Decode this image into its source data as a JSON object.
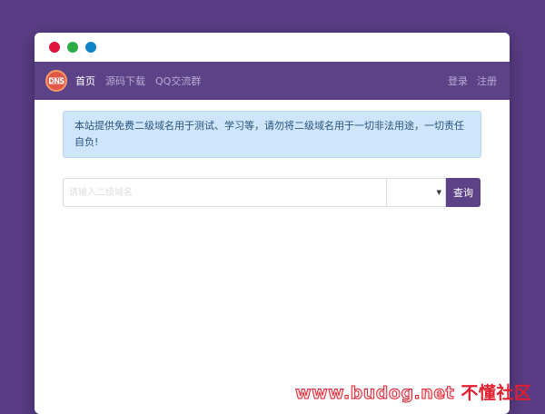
{
  "window": {
    "controls": [
      "close",
      "minimize",
      "maximize"
    ]
  },
  "navbar": {
    "logo_text": "DNS",
    "links": [
      {
        "label": "首页",
        "active": true
      },
      {
        "label": "源码下载",
        "active": false
      },
      {
        "label": "QQ交流群",
        "active": false
      }
    ],
    "right_links": [
      {
        "label": "登录"
      },
      {
        "label": "注册"
      }
    ]
  },
  "alert": {
    "text": "本站提供免费二级域名用于测试、学习等，请勿将二级域名用于一切非法用途，一切责任自负!"
  },
  "search": {
    "input_value": "",
    "input_placeholder": "请输入二级域名",
    "suffix_selected": "",
    "button_label": "查询"
  },
  "watermark": {
    "url": "www.budog.net",
    "name": "不懂社区"
  },
  "colors": {
    "background": "#5a3d86",
    "navbar": "#5c4388",
    "alert_bg": "#cfe5fb",
    "alert_text": "#29527d",
    "button": "#5c4388",
    "dot_red": "#e2143f",
    "dot_green": "#2eaa47",
    "dot_blue": "#1184cc"
  }
}
